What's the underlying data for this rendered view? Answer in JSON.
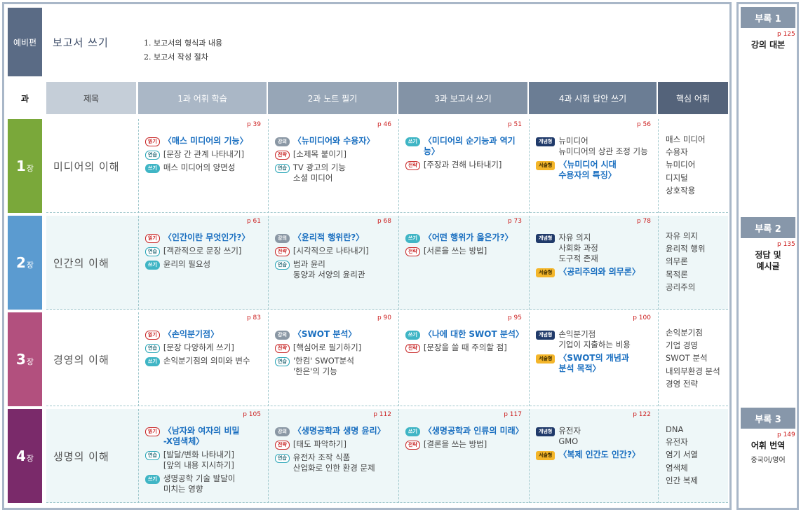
{
  "prelude": {
    "label": "예비편",
    "title": "보고서 쓰기",
    "items": [
      "1. 보고서의 형식과 내용",
      "2. 보고서 작성 절차"
    ]
  },
  "header": {
    "col_lesson": "과",
    "col_title": "제목",
    "col1": "1과 어휘 학습",
    "col2": "2과 노트 필기",
    "col3": "3과 보고서 쓰기",
    "col4": "4과 시험 답안 쓰기",
    "col5": "핵심 어휘"
  },
  "chapters": [
    {
      "num": "1",
      "unit": "장",
      "title": "미디어의 이해",
      "c1": {
        "page": "p 39",
        "lines": [
          {
            "badge": "읽기",
            "text": "〈매스 미디어의 기능〉"
          },
          {
            "badge": "연습",
            "text": "[문장 간 관계 나타내기]"
          },
          {
            "badge": "쓰기",
            "text": "매스 미디어의 양면성"
          }
        ]
      },
      "c2": {
        "page": "p 46",
        "lines": [
          {
            "badge": "강의",
            "text": "〈뉴미디어와 수용자〉"
          },
          {
            "badge": "전략",
            "text": "[소제목 붙이기]"
          },
          {
            "badge": "연습",
            "text": "TV 광고의 기능",
            "text2": "소셜 미디어"
          }
        ]
      },
      "c3": {
        "page": "p 51",
        "lines": [
          {
            "badge": "쓰기",
            "text": "〈미디어의 순기능과 역기능〉"
          },
          {
            "badge": "전략",
            "text": "[주장과 견해 나타내기]"
          }
        ]
      },
      "c4": {
        "page": "p 56",
        "lines": [
          {
            "badge": "개념형",
            "text": "뉴미디어",
            "text2": "뉴미디어의 상관 조정 기능"
          },
          {
            "badge": "서술형",
            "text": "〈뉴미디어 시대",
            "text2": "수용자의 특징〉"
          }
        ]
      },
      "keywords": [
        "매스 미디어",
        "수용자",
        "뉴미디어",
        "디지털",
        "상호작용"
      ]
    },
    {
      "num": "2",
      "unit": "장",
      "title": "인간의 이해",
      "c1": {
        "page": "p 61",
        "lines": [
          {
            "badge": "읽기",
            "text": "〈인간이란 무엇인가?〉"
          },
          {
            "badge": "연습",
            "text": "[객관적으로 문장 쓰기]"
          },
          {
            "badge": "쓰기",
            "text": "윤리의 필요성"
          }
        ]
      },
      "c2": {
        "page": "p 68",
        "lines": [
          {
            "badge": "강의",
            "text": "〈윤리적 행위란?〉"
          },
          {
            "badge": "전략",
            "text": "[시각적으로 나타내기]"
          },
          {
            "badge": "연습",
            "text": "법과 윤리",
            "text2": "동양과 서양의 윤리관"
          }
        ]
      },
      "c3": {
        "page": "p 73",
        "lines": [
          {
            "badge": "쓰기",
            "text": "〈어떤 행위가 옳은가?〉"
          },
          {
            "badge": "전략",
            "text": "[서론을 쓰는 방법]"
          }
        ]
      },
      "c4": {
        "page": "p 78",
        "lines": [
          {
            "badge": "개념형",
            "text": "자유 의지",
            "text2": "사회화 과정",
            "text3": "도구적 존재"
          },
          {
            "badge": "서술형",
            "text": "〈공리주의와 의무론〉"
          }
        ]
      },
      "keywords": [
        "자유 의지",
        "윤리적 행위",
        "의무론",
        "목적론",
        "공리주의"
      ]
    },
    {
      "num": "3",
      "unit": "장",
      "title": "경영의 이해",
      "c1": {
        "page": "p 83",
        "lines": [
          {
            "badge": "읽기",
            "text": "〈손익분기점〉"
          },
          {
            "badge": "연습",
            "text": "[문장 다양하게 쓰기]"
          },
          {
            "badge": "쓰기",
            "text": "손익분기점의 의미와 변수"
          }
        ]
      },
      "c2": {
        "page": "p 90",
        "lines": [
          {
            "badge": "강의",
            "text": "〈SWOT 분석〉"
          },
          {
            "badge": "전략",
            "text": "[핵심어로 필기하기]"
          },
          {
            "badge": "연습",
            "text": "'한컴' SWOT분석",
            "text2": "'한은'의 기능"
          }
        ]
      },
      "c3": {
        "page": "p 95",
        "lines": [
          {
            "badge": "쓰기",
            "text": "〈나에 대한 SWOT 분석〉"
          },
          {
            "badge": "전략",
            "text": "[문장을 쓸 때 주의할 점]"
          }
        ]
      },
      "c4": {
        "page": "p 100",
        "lines": [
          {
            "badge": "개념형",
            "text": "손익분기점",
            "text2": "기업이 지출하는 비용"
          },
          {
            "badge": "서술형",
            "text": "〈SWOT의 개념과",
            "text2": "분석 목적〉"
          }
        ]
      },
      "keywords": [
        "손익분기점",
        "기업 경영",
        "SWOT 분석",
        "내외부환경 분석",
        "경영 전략"
      ]
    },
    {
      "num": "4",
      "unit": "장",
      "title": "생명의 이해",
      "c1": {
        "page": "p 105",
        "lines": [
          {
            "badge": "읽기",
            "text": "〈남자와 여자의 비밀",
            "text2": "-X염색체〉"
          },
          {
            "badge": "연습",
            "text": "[발달/변화 나타내기]",
            "text2": "[앞의 내용 지시하기]"
          },
          {
            "badge": "쓰기",
            "text": "생명공학 기술 발달이",
            "text2": "미치는 영향"
          }
        ]
      },
      "c2": {
        "page": "p 112",
        "lines": [
          {
            "badge": "강의",
            "text": "〈생명공학과 생명 윤리〉"
          },
          {
            "badge": "전략",
            "text": "[태도 파악하기]"
          },
          {
            "badge": "연습",
            "text": "유전자 조작 식품",
            "text2": "산업화로 인한 환경 문제"
          }
        ]
      },
      "c3": {
        "page": "p 117",
        "lines": [
          {
            "badge": "쓰기",
            "text": "〈생명공학과 인류의 미래〉"
          },
          {
            "badge": "전략",
            "text": "[결론을 쓰는 방법]"
          }
        ]
      },
      "c4": {
        "page": "p 122",
        "lines": [
          {
            "badge": "개념형",
            "text": "유전자",
            "text2": "GMO"
          },
          {
            "badge": "서술형",
            "text": "〈복제 인간도 인간?〉"
          }
        ]
      },
      "keywords": [
        "DNA",
        "유전자",
        "염기 서열",
        "염색체",
        "인간 복제"
      ]
    }
  ],
  "appendix": [
    {
      "label": "부록 1",
      "page": "p 125",
      "title": "강의 대본",
      "title2": "",
      "sub": ""
    },
    {
      "label": "부록 2",
      "page": "p 135",
      "title": "정답 및",
      "title2": "예시글",
      "sub": ""
    },
    {
      "label": "부록 3",
      "page": "p 149",
      "title": "어휘 번역",
      "title2": "",
      "sub": "중국어/영어"
    }
  ],
  "colors": {
    "ch1": "#7aa83a",
    "ch2": "#5b9bd0",
    "ch3": "#b2507e",
    "ch4": "#7a2a6a",
    "prelude": "#5a6b85",
    "frame": "#a9b7c8"
  }
}
